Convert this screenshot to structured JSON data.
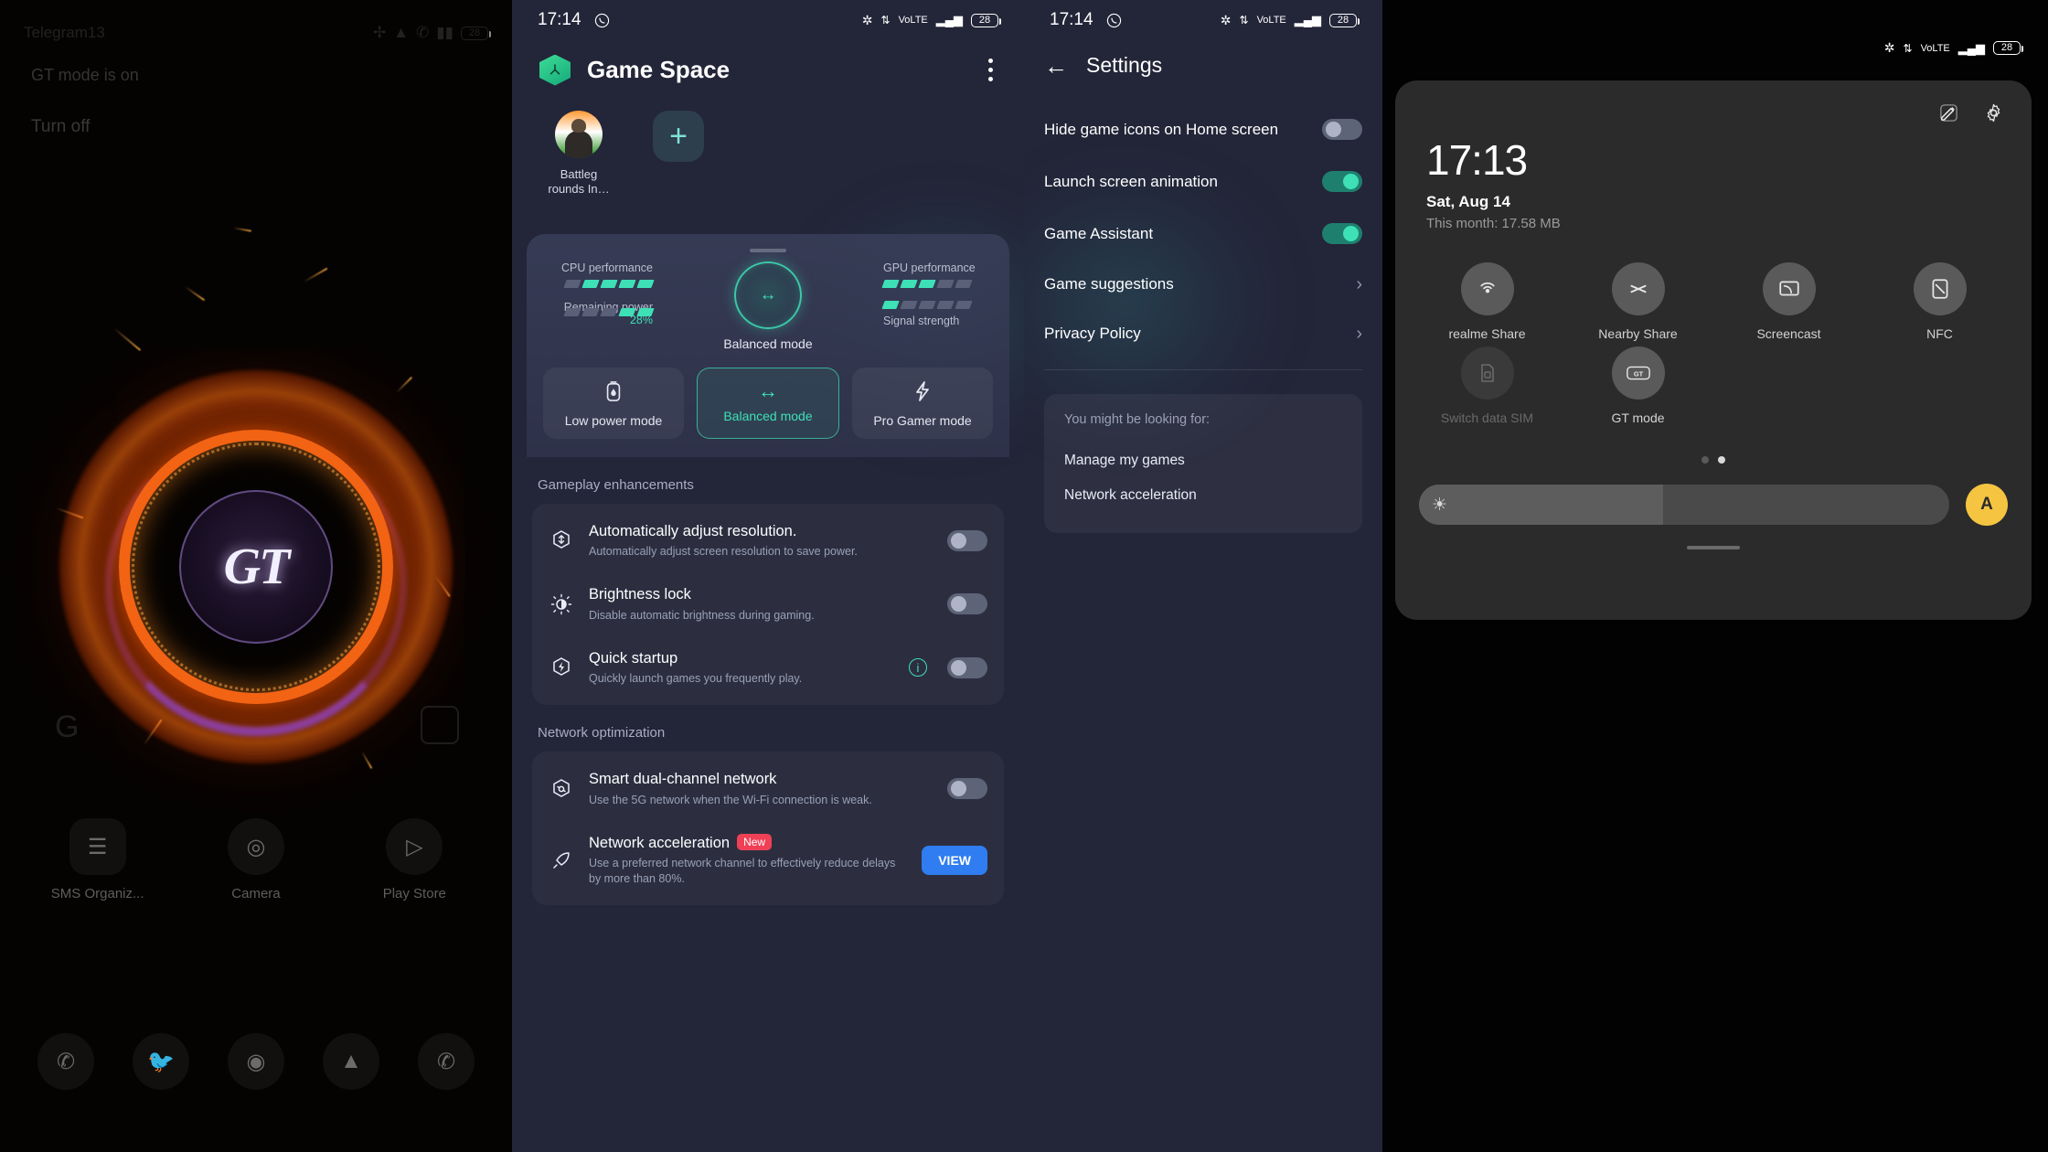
{
  "panel1": {
    "name": "gt-wallpaper-home-screen",
    "statusbar": {
      "left_text": "Telegram13",
      "icons": [
        "bluetooth-icon",
        "wifi-icon",
        "call-icon",
        "signal-icon",
        "battery-icon"
      ]
    },
    "toast": "GT mode is on",
    "toast_button": "Turn off",
    "logo_text": "GT",
    "dock_row1": [
      {
        "label": "SMS Organiz...",
        "icon": "sms-icon"
      },
      {
        "label": "Camera",
        "icon": "camera-icon"
      },
      {
        "label": "Play Store",
        "icon": "play-store-icon"
      }
    ],
    "dock_row2": [
      {
        "label": "Phone",
        "icon": "phone-icon"
      },
      {
        "label": "Twitter",
        "icon": "twitter-icon"
      },
      {
        "label": "Chrome",
        "icon": "chrome-icon"
      },
      {
        "label": "Photos",
        "icon": "photos-icon"
      },
      {
        "label": "WhatsApp",
        "icon": "whatsapp-icon"
      }
    ]
  },
  "panel2": {
    "name": "game-space",
    "statusbar": {
      "time": "17:14",
      "app_icon": "whatsapp-icon",
      "battery": "28"
    },
    "header": {
      "title": "Game Space",
      "icon": "game-space-icon",
      "menu": "kebab-menu-icon"
    },
    "apps": [
      {
        "label": "Battleg rounds In…",
        "icon": "battlegrounds-avatar"
      }
    ],
    "add_label": "+",
    "performance": {
      "cpu_label": "CPU performance",
      "cpu_bars_on": 4,
      "cpu_bars_total": 5,
      "gpu_label": "GPU performance",
      "gpu_bars_on": 3,
      "gpu_bars_total": 5,
      "power_label": "Remaining power",
      "power_value": "28%",
      "power_bars_on": 2,
      "power_bars_total": 5,
      "signal_label": "Signal strength",
      "signal_bars_on": 1,
      "signal_bars_total": 5,
      "dial_label": "Balanced mode",
      "dial_icon": "balanced-mode-icon"
    },
    "modes": [
      {
        "label": "Low power mode",
        "icon": "battery-drop-icon",
        "active": false
      },
      {
        "label": "Balanced mode",
        "icon": "balanced-icon",
        "active": true
      },
      {
        "label": "Pro Gamer mode",
        "icon": "lightning-icon",
        "active": false
      }
    ],
    "gameplay_section": "Gameplay enhancements",
    "gameplay_rows": [
      {
        "title": "Automatically adjust resolution.",
        "desc": "Automatically adjust screen resolution to save power.",
        "icon": "resolution-icon",
        "toggle": false,
        "has_info": false
      },
      {
        "title": "Brightness lock",
        "desc": "Disable automatic brightness during gaming.",
        "icon": "brightness-icon",
        "toggle": false,
        "has_info": false
      },
      {
        "title": "Quick startup",
        "desc": "Quickly launch games you frequently play.",
        "icon": "quick-startup-icon",
        "toggle": false,
        "has_info": true
      }
    ],
    "network_section": "Network optimization",
    "network_rows": [
      {
        "title": "Smart dual-channel network",
        "desc": "Use the 5G network when the Wi-Fi connection is weak.",
        "icon": "dual-channel-icon",
        "toggle": false,
        "badge": "",
        "button": ""
      },
      {
        "title": "Network acceleration",
        "desc": "Use a preferred network channel to effectively reduce delays by more than 80%.",
        "icon": "rocket-icon",
        "toggle": null,
        "badge": "New",
        "button": "VIEW"
      }
    ]
  },
  "panel3": {
    "name": "game-space-settings",
    "statusbar": {
      "time": "17:14",
      "app_icon": "whatsapp-icon",
      "battery": "28"
    },
    "title": "Settings",
    "back_icon": "back-arrow-icon",
    "rows": [
      {
        "label": "Hide game icons on Home screen",
        "type": "toggle",
        "on": false
      },
      {
        "label": "Launch screen animation",
        "type": "toggle",
        "on": true
      },
      {
        "label": "Game Assistant",
        "type": "toggle",
        "on": true
      },
      {
        "label": "Game suggestions",
        "type": "chevron"
      },
      {
        "label": "Privacy Policy",
        "type": "chevron"
      }
    ],
    "looking_for": {
      "heading": "You might be looking for:",
      "items": [
        "Manage my games",
        "Network acceleration"
      ]
    }
  },
  "panel4": {
    "name": "control-center",
    "statusbar": {
      "battery": "28",
      "icons": [
        "bluetooth-icon",
        "vpn-icon",
        "volte-icon",
        "signal-icon",
        "battery-icon"
      ]
    },
    "top_actions": [
      {
        "icon": "edit-icon",
        "name": "edit-button"
      },
      {
        "icon": "gear-icon",
        "name": "settings-button"
      }
    ],
    "time": "17:13",
    "date": "Sat, Aug 14",
    "usage": "This month: 17.58 MB",
    "tiles": [
      {
        "label": "realme Share",
        "icon": "realme-share-icon",
        "dim": false
      },
      {
        "label": "Nearby Share",
        "icon": "nearby-share-icon",
        "dim": false
      },
      {
        "label": "Screencast",
        "icon": "screencast-icon",
        "dim": false
      },
      {
        "label": "NFC",
        "icon": "nfc-icon",
        "dim": false
      },
      {
        "label": "Switch data SIM",
        "icon": "sim-icon",
        "dim": true
      },
      {
        "label": "GT mode",
        "icon": "gt-mode-icon",
        "dim": false
      }
    ],
    "page_dots": {
      "count": 2,
      "active": 1
    },
    "brightness": {
      "icon": "brightness-icon",
      "value_pct": 46
    },
    "auto_button": "A"
  },
  "colors": {
    "accent_teal": "#3ee0b5",
    "panel_bg": "#232538",
    "cc_bg": "#2b2b2b",
    "badge_red": "#ef4056",
    "view_blue": "#2f7df0",
    "gt_orange": "#ff6814",
    "auto_yellow": "#f5c542"
  }
}
